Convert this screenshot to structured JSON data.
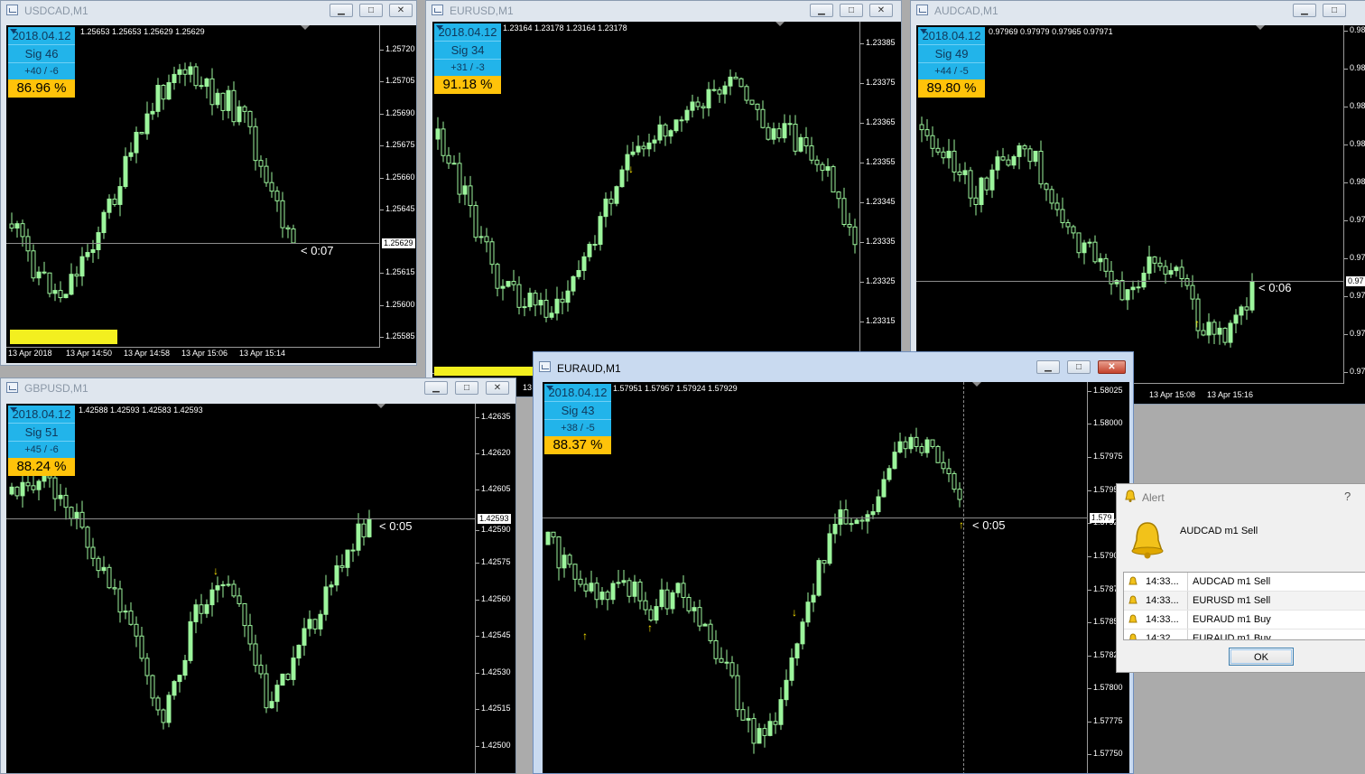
{
  "windows": {
    "usdcad": {
      "title": "USDCAD,M1",
      "ohlc": "1.25653 1.25653 1.25629 1.25629",
      "panel": {
        "date": "2018.04.12",
        "sig": "Sig  46",
        "score": "+40 / -6",
        "pct": "86.96 %"
      },
      "price_labels": [
        "1.25720",
        "1.25705",
        "1.25690",
        "1.25675",
        "1.25660",
        "1.25645",
        "1.25615",
        "1.25600",
        "1.25585"
      ],
      "current_price": "1.25629",
      "timer": "< 0:07",
      "time_labels": [
        "13 Apr 2018",
        "13 Apr 14:50",
        "13 Apr 14:58",
        "13 Apr 15:06",
        "13 Apr 15:14"
      ]
    },
    "eurusd": {
      "title": "EURUSD,M1",
      "ohlc": "1.23164 1.23178 1.23164 1.23178",
      "panel": {
        "date": "2018.04.12",
        "sig": "Sig  34",
        "score": "+31 / -3",
        "pct": "91.18 %"
      },
      "price_labels": [
        "1.23385",
        "1.23375",
        "1.23365",
        "1.23355",
        "1.23345",
        "1.23335",
        "1.23325",
        "1.23315"
      ],
      "time_labels": [
        "13"
      ]
    },
    "audcad": {
      "title": "AUDCAD,M1",
      "ohlc": "0.97969 0.97979 0.97965 0.97971",
      "panel": {
        "date": "2018.04.12",
        "sig": "Sig  49",
        "score": "+44 / -5",
        "pct": "89.80 %"
      },
      "price_labels": [
        "0.98",
        "0.98",
        "0.98",
        "0.98",
        "0.98",
        "0.97",
        "0.97",
        "0.97",
        "0.97",
        "0.97",
        "0.97"
      ],
      "current_price": "0.97",
      "timer": "< 0:06",
      "time_labels": [
        "13 Apr 15:08",
        "13 Apr 15:16"
      ]
    },
    "gbpusd": {
      "title": "GBPUSD,M1",
      "ohlc": "1.42588 1.42593 1.42583 1.42593",
      "panel": {
        "date": "2018.04.12",
        "sig": "Sig  51",
        "score": "+45 / -6",
        "pct": "88.24 %"
      },
      "price_labels": [
        "1.42635",
        "1.42620",
        "1.42605",
        "1.42590",
        "1.42575",
        "1.42560",
        "1.42545",
        "1.42530",
        "1.42515",
        "1.42500"
      ],
      "current_price": "1.42593",
      "timer": "< 0:05"
    },
    "euraud": {
      "title": "EURAUD,M1",
      "ohlc": "1.57951 1.57957 1.57924 1.57929",
      "panel": {
        "date": "2018.04.12",
        "sig": "Sig  43",
        "score": "+38 / -5",
        "pct": "88.37 %"
      },
      "price_labels": [
        "1.58025",
        "1.58000",
        "1.57975",
        "1.5795",
        "1.57925",
        "1.57900",
        "1.5787",
        "1.5785",
        "1.5782",
        "1.57800",
        "1.57775",
        "1.57750"
      ],
      "current_price": "1.579",
      "timer": "< 0:05"
    }
  },
  "controls": {
    "minimize": "▁",
    "maximize": "□",
    "close": "✕"
  },
  "alert": {
    "title": "Alert",
    "help": "?",
    "message": "AUDCAD  m1  Sell",
    "rows": [
      {
        "time": "14:33...",
        "msg": "AUDCAD  m1  Sell"
      },
      {
        "time": "14:33...",
        "msg": "EURUSD  m1  Sell"
      },
      {
        "time": "14:33...",
        "msg": "EURAUD  m1  Buy"
      },
      {
        "time": "14:32...",
        "msg": "EURAUD  m1  Buy"
      }
    ],
    "ok": "OK"
  },
  "colors": {
    "candle": "#9cf59c",
    "background": "#000000",
    "panel_blue": "#22b4ea",
    "panel_gold": "#ffc30a",
    "signal_arrow": "#ffe800"
  }
}
